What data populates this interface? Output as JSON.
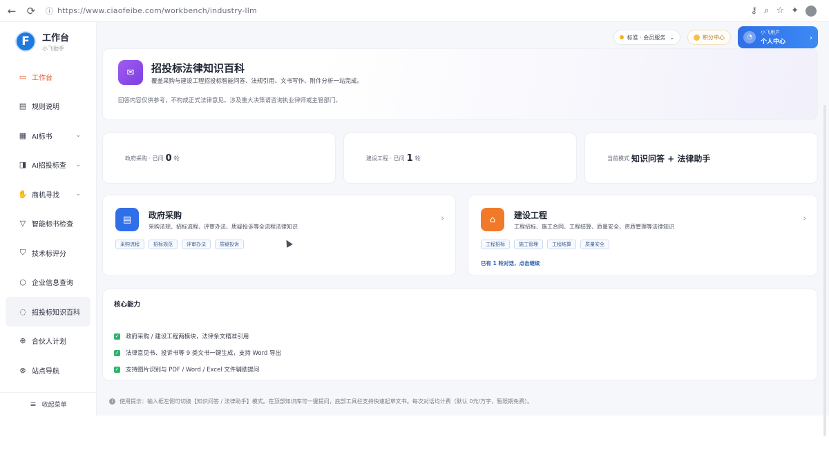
{
  "browser": {
    "url": "https://www.ciaofeibe.com/workbench/industry-llm",
    "back_icon": "←",
    "reload_icon": "⟳",
    "lock_icon": "ⓘ",
    "key_icon": "⚷",
    "zoom_icon": "⌕",
    "star_icon": "☆",
    "ext_icon": "✦"
  },
  "sidebar": {
    "logo_letter": "F",
    "app_title": "工作台",
    "app_subtitle": "小飞助手",
    "items": [
      {
        "icon": "▭",
        "label": "工作台",
        "has_chevron": false
      },
      {
        "icon": "▤",
        "label": "规则说明",
        "has_chevron": false
      },
      {
        "icon": "▦",
        "label": "AI标书",
        "has_chevron": true
      },
      {
        "icon": "◨",
        "label": "AI招投标查",
        "has_chevron": true
      },
      {
        "icon": "✋",
        "label": "商机寻找",
        "has_chevron": true
      },
      {
        "icon": "▽",
        "label": "智能标书检查",
        "has_chevron": false
      },
      {
        "icon": "⛉",
        "label": "技术标评分",
        "has_chevron": false
      },
      {
        "icon": "○",
        "label": "企业信息查询",
        "has_chevron": false
      },
      {
        "icon": "◌",
        "label": "招投标知识百科",
        "has_chevron": false
      },
      {
        "icon": "⊕",
        "label": "合伙人计划",
        "has_chevron": false
      },
      {
        "icon": "⊗",
        "label": "站点导航",
        "has_chevron": false
      }
    ],
    "collapse_icon": "≡",
    "collapse_label": "收起菜单"
  },
  "topbar": {
    "region_label": "标准 · 会员服务",
    "points_label": "积分中心",
    "user_name": "小飞用户",
    "user_console": "个人中心"
  },
  "hero": {
    "icon": "✉",
    "title": "招投标法律知识百科",
    "description": "覆盖采购与建设工程招投标智能问答、法规引用、文书写作、附件分析一站完成。",
    "note": "回答内容仅供参考，不构成正式法律意见。涉及重大决策请咨询执业律师或主管部门。"
  },
  "stats": [
    {
      "prefix": "政府采购 · 已问",
      "value": "0",
      "suffix": "轮"
    },
    {
      "prefix": "建设工程 · 已问",
      "value": "1",
      "suffix": "轮"
    },
    {
      "prefix": "当前模式",
      "value": "知识问答 + 法律助手",
      "suffix": ""
    }
  ],
  "categories": [
    {
      "title": "政府采购",
      "description": "采购法规、招标流程、评审办法、质疑投诉等全流程法律知识",
      "tags": [
        "采购流程",
        "招标规范",
        "评审办法",
        "质疑投诉"
      ],
      "extra": "",
      "color": "#2f6fe8",
      "icon": "▤"
    },
    {
      "title": "建设工程",
      "description": "工程招标、施工合同、工程结算、质量安全、资质管理等法律知识",
      "tags": [
        "工程招标",
        "施工管理",
        "工程结算",
        "质量安全"
      ],
      "extra": "已有 1 轮对话，点击继续",
      "color": "#f07a2a",
      "icon": "⌂"
    }
  ],
  "core": {
    "title": "核心能力",
    "items": [
      "政府采购 / 建设工程两模块，法律条文精准引用",
      "法律意见书、投诉书等 9 类文书一键生成，支持 Word 导出",
      "支持图片识别与 PDF / Word / Excel 文件辅助提问"
    ]
  },
  "tip": {
    "icon": "i",
    "text": "使用提示：输入框左侧可切换【知识问答 / 法律助手】模式。在顶部知识库可一键提问，底部工具栏支持快速起草文书。每次对话均计费（默认 0元/万字，暂限期免费）。"
  }
}
